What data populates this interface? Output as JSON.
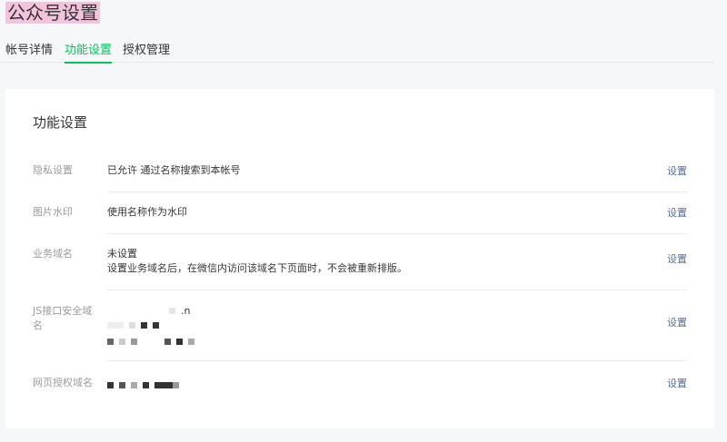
{
  "title": "公众号设置",
  "tabs": [
    {
      "label": "帐号详情"
    },
    {
      "label": "功能设置"
    },
    {
      "label": "授权管理"
    }
  ],
  "card": {
    "heading": "功能设置",
    "rows": [
      {
        "label": "隐私设置",
        "value": "已允许 通过名称搜索到本帐号",
        "action": "设置"
      },
      {
        "label": "图片水印",
        "value": "使用名称作为水印",
        "action": "设置"
      },
      {
        "label": "业务域名",
        "value": "未设置",
        "hint": "设置业务域名后，在微信内访问该域名下页面时，不会被重新排版。",
        "action": "设置"
      },
      {
        "label": "JS接口安全域名",
        "value": ".n",
        "action": "设置"
      },
      {
        "label": "网页授权域名",
        "action": "设置"
      }
    ]
  }
}
